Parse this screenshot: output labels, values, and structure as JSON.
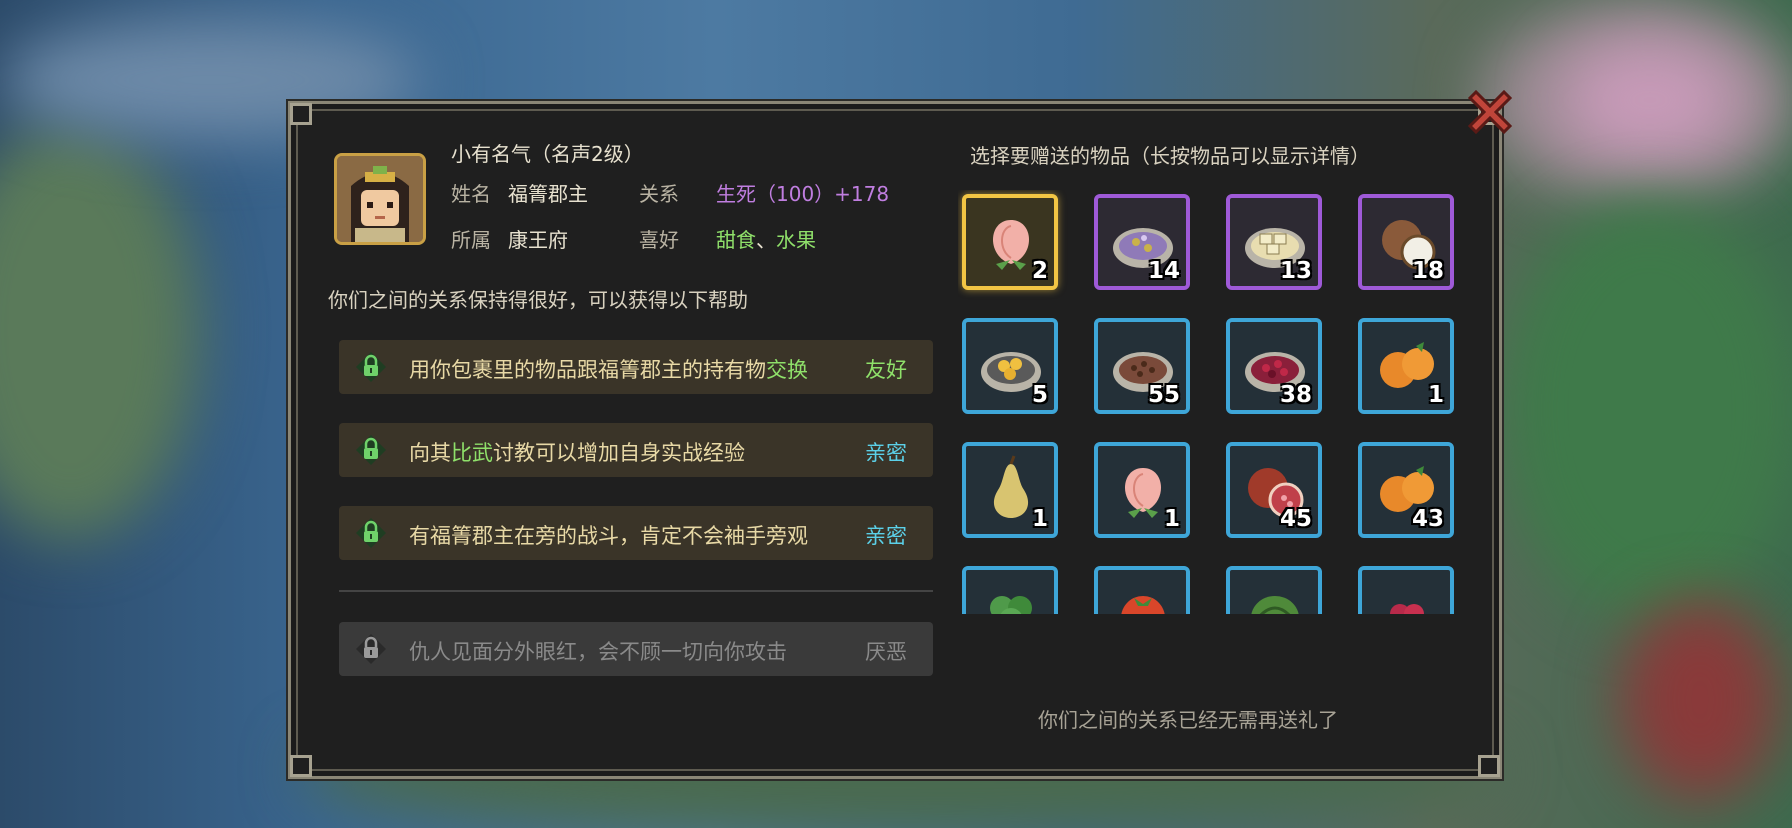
{
  "character": {
    "fame_title": "小有名气（名声2级）",
    "name_label": "姓名",
    "name": "福箐郡主",
    "relation_label": "关系",
    "relation_value": "生死（100）+178",
    "faction_label": "所属",
    "faction": "康王府",
    "likes_label": "喜好",
    "likes_food": "甜食",
    "likes_sep": "、",
    "likes_fruit": "水果"
  },
  "relation_note": "你们之间的关系保持得很好，可以获得以下帮助",
  "help_options": [
    {
      "pre": "用你包裹里的物品跟福箐郡主的持有物",
      "highlight": "交换",
      "post": "",
      "tag": "友好",
      "tag_color": "#8fe06a",
      "enabled": true
    },
    {
      "pre": "向其",
      "highlight": "比武",
      "post": "讨教可以增加自身实战经验",
      "tag": "亲密",
      "tag_color": "#5bd0e8",
      "enabled": true
    },
    {
      "pre": "有福箐郡主在旁的战斗，肯定不会袖手旁观",
      "highlight": "",
      "post": "",
      "tag": "亲密",
      "tag_color": "#5bd0e8",
      "enabled": true
    },
    {
      "pre": "仇人见面分外眼红，会不顾一切向你攻击",
      "highlight": "",
      "post": "",
      "tag": "厌恶",
      "tag_color": "#8a8a8a",
      "enabled": false
    }
  ],
  "gift_header": "选择要赠送的物品（长按物品可以显示详情）",
  "gift_note": "你们之间的关系已经无需再送礼了",
  "items": [
    {
      "icon": "peach-icon",
      "qty": "2",
      "rarity": "gold"
    },
    {
      "icon": "purple-cake-plate-icon",
      "qty": "14",
      "rarity": "purple"
    },
    {
      "icon": "tofu-plate-icon",
      "qty": "13",
      "rarity": "purple"
    },
    {
      "icon": "coconut-icon",
      "qty": "18",
      "rarity": "purple"
    },
    {
      "icon": "nut-plate-icon",
      "qty": "5",
      "rarity": "blue"
    },
    {
      "icon": "bean-plate-icon",
      "qty": "55",
      "rarity": "blue"
    },
    {
      "icon": "berry-plate-icon",
      "qty": "38",
      "rarity": "blue"
    },
    {
      "icon": "orange-icon",
      "qty": "1",
      "rarity": "blue"
    },
    {
      "icon": "pear-icon",
      "qty": "1",
      "rarity": "blue"
    },
    {
      "icon": "peach-icon",
      "qty": "1",
      "rarity": "blue"
    },
    {
      "icon": "pomegranate-icon",
      "qty": "45",
      "rarity": "blue"
    },
    {
      "icon": "orange-icon",
      "qty": "43",
      "rarity": "blue"
    },
    {
      "icon": "herb-icon",
      "qty": "",
      "rarity": "blue"
    },
    {
      "icon": "tomato-icon",
      "qty": "",
      "rarity": "blue"
    },
    {
      "icon": "melon-icon",
      "qty": "",
      "rarity": "blue"
    },
    {
      "icon": "raspberry-icon",
      "qty": "",
      "rarity": "blue"
    }
  ]
}
